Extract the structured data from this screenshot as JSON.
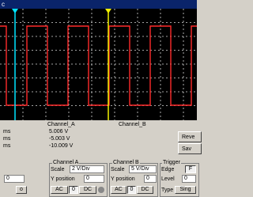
{
  "window": {
    "title": "c"
  },
  "buttons": {
    "reverse": "Reve",
    "save": "Sav"
  },
  "readout": {
    "col_a": "Channel_A",
    "col_b": "Channel_B",
    "rows": [
      {
        "label": "ms",
        "a": "5.006 V"
      },
      {
        "label": "ms",
        "a": "-5.003 V"
      },
      {
        "label": "ms",
        "a": "-10.009 V"
      }
    ]
  },
  "channel_a": {
    "title": "Channel A",
    "scale_label": "Scale",
    "scale_value": "2 V/Div",
    "ypos_label": "Y position",
    "ypos_value": "0",
    "ac": "AC",
    "zero": "0",
    "dc": "DC"
  },
  "channel_b": {
    "title": "Channel B",
    "scale_label": "Scale",
    "scale_value": "5 V/Div",
    "ypos_label": "Y position",
    "ypos_value": "0",
    "ac": "AC",
    "zero": "0",
    "dc": "DC"
  },
  "trigger": {
    "title": "Trigger",
    "edge_label": "Edge",
    "level_label": "Level",
    "level_value": "0",
    "type_label": "Type",
    "type_value": "Sing",
    "edge_value": "F"
  },
  "left_panel": {
    "y_value": "0",
    "flag": "o"
  },
  "colors": {
    "trace_a": "#ff2a2a",
    "cursor1": "#00e5ff",
    "cursor2": "#f2f200",
    "grid": "#d8d8d8"
  }
}
